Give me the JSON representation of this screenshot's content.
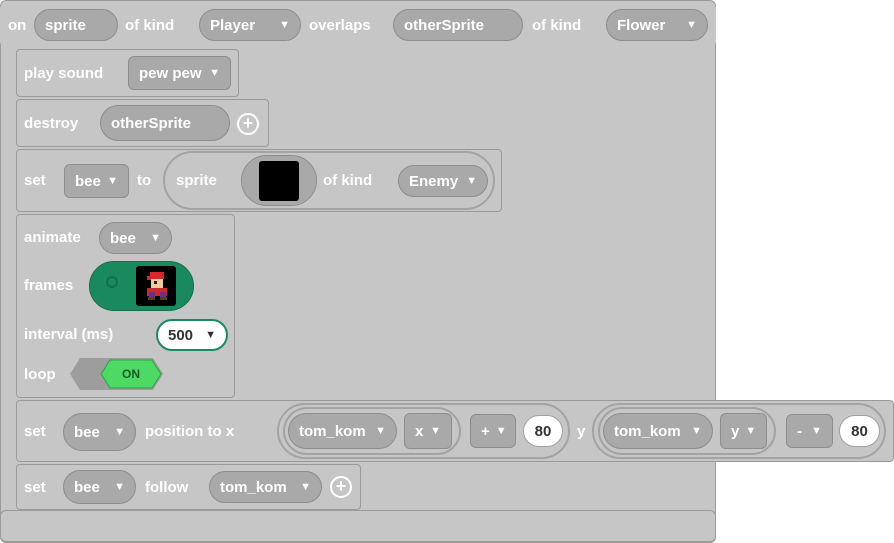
{
  "event": {
    "on": "on",
    "sprite_var": "sprite",
    "of_kind_1": "of kind",
    "kind_1": "Player",
    "overlaps": "overlaps",
    "other_var": "otherSprite",
    "of_kind_2": "of kind",
    "kind_2": "Flower"
  },
  "play_sound": {
    "label": "play sound",
    "sound": "pew pew"
  },
  "destroy": {
    "label": "destroy",
    "target": "otherSprite"
  },
  "set_sprite": {
    "set": "set",
    "var": "bee",
    "to": "to",
    "sprite": "sprite",
    "of_kind": "of kind",
    "kind": "Enemy"
  },
  "animate": {
    "label": "animate",
    "var": "bee",
    "frames": "frames",
    "interval_label": "interval (ms)",
    "interval": "500",
    "loop_label": "loop",
    "loop_state": "ON"
  },
  "set_position": {
    "set": "set",
    "var": "bee",
    "label": "position to x",
    "x_sprite": "tom_kom",
    "x_prop": "x",
    "x_op": "+",
    "x_val": "80",
    "y_label": "y",
    "y_sprite": "tom_kom",
    "y_prop": "y",
    "y_op": "-",
    "y_val": "80"
  },
  "set_follow": {
    "set": "set",
    "var": "bee",
    "follow": "follow",
    "target": "tom_kom"
  },
  "colors": {
    "block": "#c6c6c6",
    "field": "#a9a9a9",
    "frames": "#1a8a5e",
    "toggle_on": "#4cd964"
  }
}
